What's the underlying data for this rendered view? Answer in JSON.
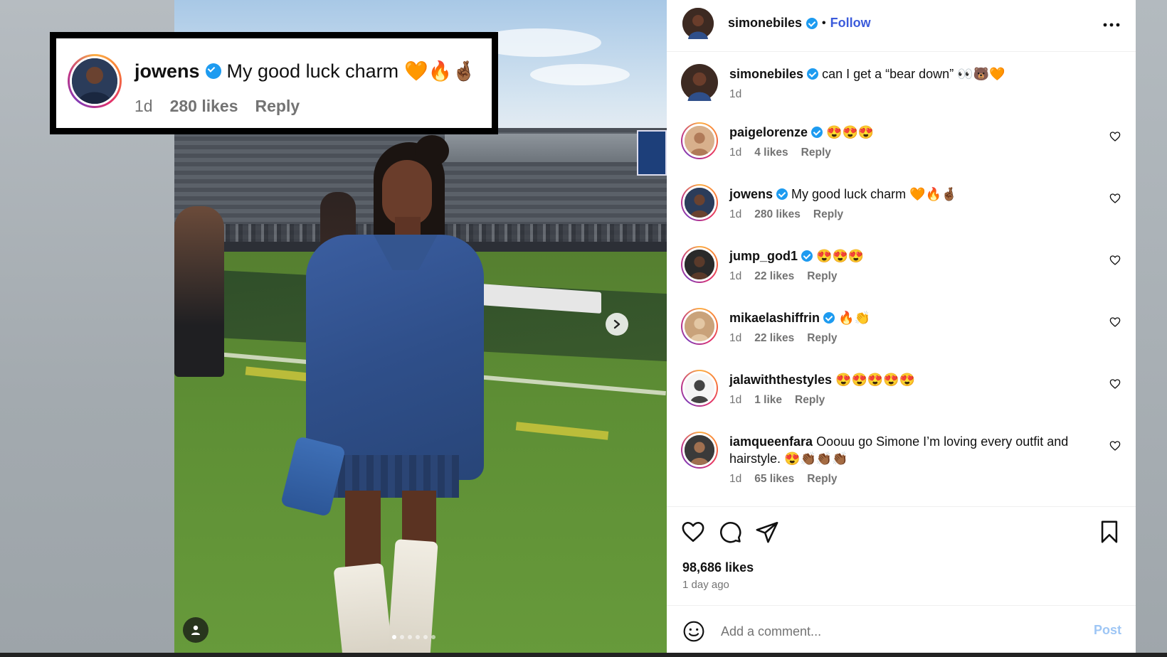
{
  "colors": {
    "follow": "#3b5bdb",
    "verified": "#1d9bf0",
    "meta": "#737373",
    "post_disabled": "#9ec6f5"
  },
  "callout": {
    "username": "jowens",
    "text": "My good luck charm",
    "emoji": "🧡🔥🤞🏾",
    "time": "1d",
    "likes": "280 likes",
    "reply": "Reply"
  },
  "post": {
    "header": {
      "username": "simonebiles",
      "separator": "•",
      "follow": "Follow",
      "more": "•••"
    },
    "caption": {
      "username": "simonebiles",
      "text": "can I get a “bear down” 👀🐻🧡",
      "time": "1d"
    },
    "comments": [
      {
        "username": "paigelorenze",
        "verified": true,
        "text": "😍😍😍",
        "time": "1d",
        "likes": "4 likes",
        "reply": "Reply"
      },
      {
        "username": "jowens",
        "verified": true,
        "text": "My good luck charm 🧡🔥🤞🏾",
        "time": "1d",
        "likes": "280 likes",
        "reply": "Reply"
      },
      {
        "username": "jump_god1",
        "verified": true,
        "text": "😍😍😍",
        "time": "1d",
        "likes": "22 likes",
        "reply": "Reply"
      },
      {
        "username": "mikaelashiffrin",
        "verified": true,
        "text": "🔥👏",
        "time": "1d",
        "likes": "22 likes",
        "reply": "Reply"
      },
      {
        "username": "jalawiththestyles",
        "verified": false,
        "text": "😍😍😍😍😍",
        "time": "1d",
        "likes": "1 like",
        "reply": "Reply"
      },
      {
        "username": "iamqueenfara",
        "verified": false,
        "text": "Ooouu go Simone I’m loving every outfit and hairstyle. 😍👏🏾👏🏾👏🏾",
        "time": "1d",
        "likes": "65 likes",
        "reply": "Reply"
      }
    ],
    "likes": "98,686 likes",
    "time_ago": "1 day ago",
    "comment_placeholder": "Add a comment...",
    "post_label": "Post"
  },
  "icons": {
    "more": "more-icon",
    "heart": "heart-icon",
    "comment": "comment-icon",
    "share": "share-icon",
    "save": "bookmark-icon",
    "emoji": "emoji-icon",
    "next": "chevron-right-icon",
    "user_tag": "user-tag-icon"
  },
  "carousel": {
    "slides": 6,
    "active": 1
  }
}
